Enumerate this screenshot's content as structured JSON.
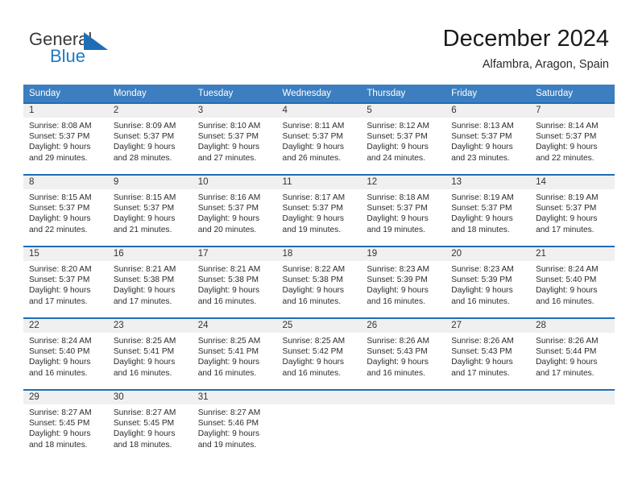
{
  "brand": {
    "name_top": "General",
    "name_bottom": "Blue",
    "triangle_icon": "triangle-icon",
    "accent_color": "#1f7ac0",
    "text_color": "#3a3a3a"
  },
  "header": {
    "title": "December 2024",
    "subtitle": "Alfambra, Aragon, Spain"
  },
  "theme": {
    "header_bg": "#3c7ebf",
    "row_border": "#1f6eb5",
    "daynum_bg": "#f0f0f0",
    "page_bg": "#ffffff"
  },
  "weekday_headers": [
    "Sunday",
    "Monday",
    "Tuesday",
    "Wednesday",
    "Thursday",
    "Friday",
    "Saturday"
  ],
  "labels": {
    "sunrise_prefix": "Sunrise:",
    "sunset_prefix": "Sunset:",
    "daylight_prefix": "Daylight:"
  },
  "weeks": [
    [
      {
        "day": "1",
        "l1": "Sunrise: 8:08 AM",
        "l2": "Sunset: 5:37 PM",
        "l3": "Daylight: 9 hours",
        "l4": "and 29 minutes."
      },
      {
        "day": "2",
        "l1": "Sunrise: 8:09 AM",
        "l2": "Sunset: 5:37 PM",
        "l3": "Daylight: 9 hours",
        "l4": "and 28 minutes."
      },
      {
        "day": "3",
        "l1": "Sunrise: 8:10 AM",
        "l2": "Sunset: 5:37 PM",
        "l3": "Daylight: 9 hours",
        "l4": "and 27 minutes."
      },
      {
        "day": "4",
        "l1": "Sunrise: 8:11 AM",
        "l2": "Sunset: 5:37 PM",
        "l3": "Daylight: 9 hours",
        "l4": "and 26 minutes."
      },
      {
        "day": "5",
        "l1": "Sunrise: 8:12 AM",
        "l2": "Sunset: 5:37 PM",
        "l3": "Daylight: 9 hours",
        "l4": "and 24 minutes."
      },
      {
        "day": "6",
        "l1": "Sunrise: 8:13 AM",
        "l2": "Sunset: 5:37 PM",
        "l3": "Daylight: 9 hours",
        "l4": "and 23 minutes."
      },
      {
        "day": "7",
        "l1": "Sunrise: 8:14 AM",
        "l2": "Sunset: 5:37 PM",
        "l3": "Daylight: 9 hours",
        "l4": "and 22 minutes."
      }
    ],
    [
      {
        "day": "8",
        "l1": "Sunrise: 8:15 AM",
        "l2": "Sunset: 5:37 PM",
        "l3": "Daylight: 9 hours",
        "l4": "and 22 minutes."
      },
      {
        "day": "9",
        "l1": "Sunrise: 8:15 AM",
        "l2": "Sunset: 5:37 PM",
        "l3": "Daylight: 9 hours",
        "l4": "and 21 minutes."
      },
      {
        "day": "10",
        "l1": "Sunrise: 8:16 AM",
        "l2": "Sunset: 5:37 PM",
        "l3": "Daylight: 9 hours",
        "l4": "and 20 minutes."
      },
      {
        "day": "11",
        "l1": "Sunrise: 8:17 AM",
        "l2": "Sunset: 5:37 PM",
        "l3": "Daylight: 9 hours",
        "l4": "and 19 minutes."
      },
      {
        "day": "12",
        "l1": "Sunrise: 8:18 AM",
        "l2": "Sunset: 5:37 PM",
        "l3": "Daylight: 9 hours",
        "l4": "and 19 minutes."
      },
      {
        "day": "13",
        "l1": "Sunrise: 8:19 AM",
        "l2": "Sunset: 5:37 PM",
        "l3": "Daylight: 9 hours",
        "l4": "and 18 minutes."
      },
      {
        "day": "14",
        "l1": "Sunrise: 8:19 AM",
        "l2": "Sunset: 5:37 PM",
        "l3": "Daylight: 9 hours",
        "l4": "and 17 minutes."
      }
    ],
    [
      {
        "day": "15",
        "l1": "Sunrise: 8:20 AM",
        "l2": "Sunset: 5:37 PM",
        "l3": "Daylight: 9 hours",
        "l4": "and 17 minutes."
      },
      {
        "day": "16",
        "l1": "Sunrise: 8:21 AM",
        "l2": "Sunset: 5:38 PM",
        "l3": "Daylight: 9 hours",
        "l4": "and 17 minutes."
      },
      {
        "day": "17",
        "l1": "Sunrise: 8:21 AM",
        "l2": "Sunset: 5:38 PM",
        "l3": "Daylight: 9 hours",
        "l4": "and 16 minutes."
      },
      {
        "day": "18",
        "l1": "Sunrise: 8:22 AM",
        "l2": "Sunset: 5:38 PM",
        "l3": "Daylight: 9 hours",
        "l4": "and 16 minutes."
      },
      {
        "day": "19",
        "l1": "Sunrise: 8:23 AM",
        "l2": "Sunset: 5:39 PM",
        "l3": "Daylight: 9 hours",
        "l4": "and 16 minutes."
      },
      {
        "day": "20",
        "l1": "Sunrise: 8:23 AM",
        "l2": "Sunset: 5:39 PM",
        "l3": "Daylight: 9 hours",
        "l4": "and 16 minutes."
      },
      {
        "day": "21",
        "l1": "Sunrise: 8:24 AM",
        "l2": "Sunset: 5:40 PM",
        "l3": "Daylight: 9 hours",
        "l4": "and 16 minutes."
      }
    ],
    [
      {
        "day": "22",
        "l1": "Sunrise: 8:24 AM",
        "l2": "Sunset: 5:40 PM",
        "l3": "Daylight: 9 hours",
        "l4": "and 16 minutes."
      },
      {
        "day": "23",
        "l1": "Sunrise: 8:25 AM",
        "l2": "Sunset: 5:41 PM",
        "l3": "Daylight: 9 hours",
        "l4": "and 16 minutes."
      },
      {
        "day": "24",
        "l1": "Sunrise: 8:25 AM",
        "l2": "Sunset: 5:41 PM",
        "l3": "Daylight: 9 hours",
        "l4": "and 16 minutes."
      },
      {
        "day": "25",
        "l1": "Sunrise: 8:25 AM",
        "l2": "Sunset: 5:42 PM",
        "l3": "Daylight: 9 hours",
        "l4": "and 16 minutes."
      },
      {
        "day": "26",
        "l1": "Sunrise: 8:26 AM",
        "l2": "Sunset: 5:43 PM",
        "l3": "Daylight: 9 hours",
        "l4": "and 16 minutes."
      },
      {
        "day": "27",
        "l1": "Sunrise: 8:26 AM",
        "l2": "Sunset: 5:43 PM",
        "l3": "Daylight: 9 hours",
        "l4": "and 17 minutes."
      },
      {
        "day": "28",
        "l1": "Sunrise: 8:26 AM",
        "l2": "Sunset: 5:44 PM",
        "l3": "Daylight: 9 hours",
        "l4": "and 17 minutes."
      }
    ],
    [
      {
        "day": "29",
        "l1": "Sunrise: 8:27 AM",
        "l2": "Sunset: 5:45 PM",
        "l3": "Daylight: 9 hours",
        "l4": "and 18 minutes."
      },
      {
        "day": "30",
        "l1": "Sunrise: 8:27 AM",
        "l2": "Sunset: 5:45 PM",
        "l3": "Daylight: 9 hours",
        "l4": "and 18 minutes."
      },
      {
        "day": "31",
        "l1": "Sunrise: 8:27 AM",
        "l2": "Sunset: 5:46 PM",
        "l3": "Daylight: 9 hours",
        "l4": "and 19 minutes."
      },
      {
        "day": "",
        "l1": "",
        "l2": "",
        "l3": "",
        "l4": ""
      },
      {
        "day": "",
        "l1": "",
        "l2": "",
        "l3": "",
        "l4": ""
      },
      {
        "day": "",
        "l1": "",
        "l2": "",
        "l3": "",
        "l4": ""
      },
      {
        "day": "",
        "l1": "",
        "l2": "",
        "l3": "",
        "l4": ""
      }
    ]
  ]
}
